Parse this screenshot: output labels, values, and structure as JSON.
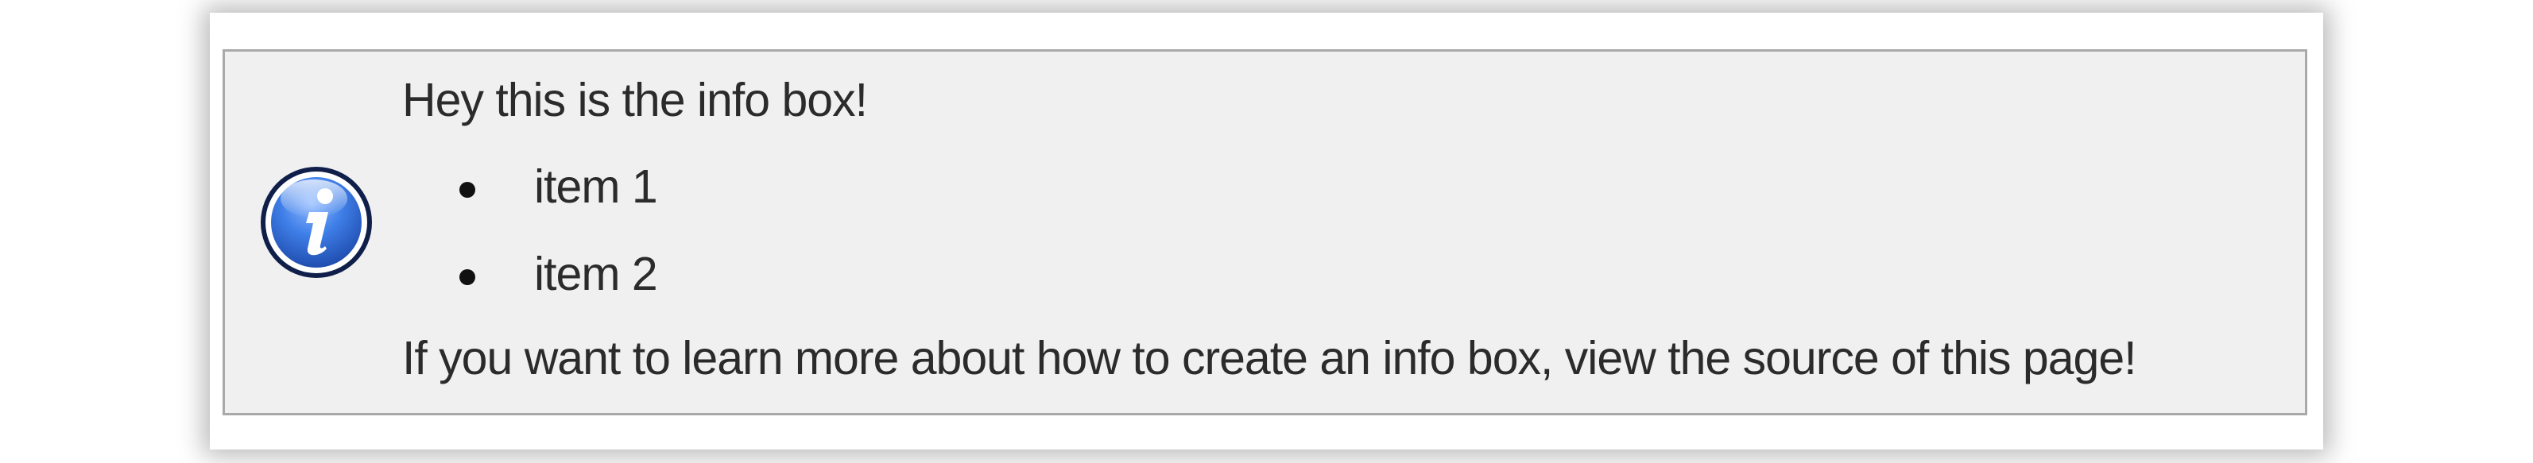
{
  "info_box": {
    "icon": "info-icon",
    "intro": "Hey this is the info box!",
    "items": [
      {
        "label": "item 1"
      },
      {
        "label": "item 2"
      }
    ],
    "outro": "If you want to learn more about how to create an info box, view the source of this page!"
  },
  "colors": {
    "box_background": "#f0f0f0",
    "box_border": "#a9a9a9",
    "icon_blue": "#2f6fd8",
    "text": "#2b2b2b"
  }
}
